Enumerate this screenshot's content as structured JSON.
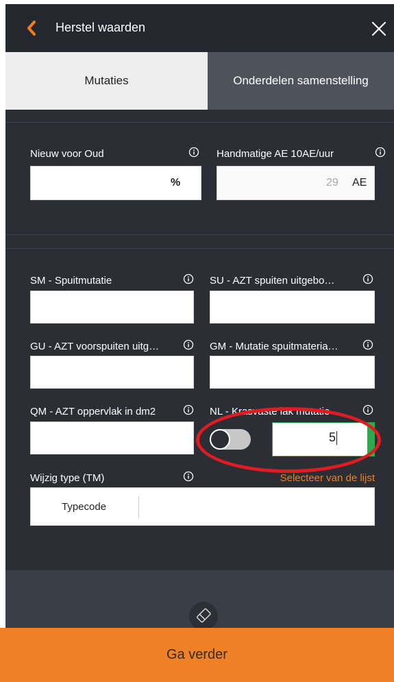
{
  "header": {
    "title": "Herstel waarden"
  },
  "tabs": [
    {
      "label": "Mutaties",
      "active": true
    },
    {
      "label": "Onderdelen samenstelling",
      "active": false
    }
  ],
  "section1": {
    "nieuw_voor_oud": {
      "label": "Nieuw voor Oud",
      "value": "",
      "unit": "%"
    },
    "handmatige_ae": {
      "label": "Handmatige AE 10AE/uur",
      "value": "29",
      "unit": "AE"
    }
  },
  "section2": {
    "sm": {
      "label": "SM - Spuitmutatie",
      "value": ""
    },
    "su": {
      "label": "SU - AZT spuiten uitgebo…",
      "value": ""
    },
    "gu": {
      "label": "GU - AZT voorspuiten uitg…",
      "value": ""
    },
    "gm": {
      "label": "GM - Mutatie spuitmateria…",
      "value": ""
    },
    "qm": {
      "label": "QM - AZT oppervlak in dm2",
      "value": ""
    },
    "nl": {
      "label": "NL - Krasvaste lak mutatie",
      "value": "5",
      "toggle_on": false
    },
    "tm": {
      "label": "Wijzig type (TM)",
      "link": "Selecteer van de lijst",
      "typecode_label": "Typecode",
      "value": ""
    }
  },
  "footer": {
    "cta_label": "Ga verder"
  },
  "colors": {
    "accent": "#f08025",
    "highlight": "#e01b22",
    "active_field": "#2fa84f"
  },
  "icons": [
    "back-chevron-icon",
    "close-icon",
    "info-icon",
    "eraser-icon"
  ]
}
